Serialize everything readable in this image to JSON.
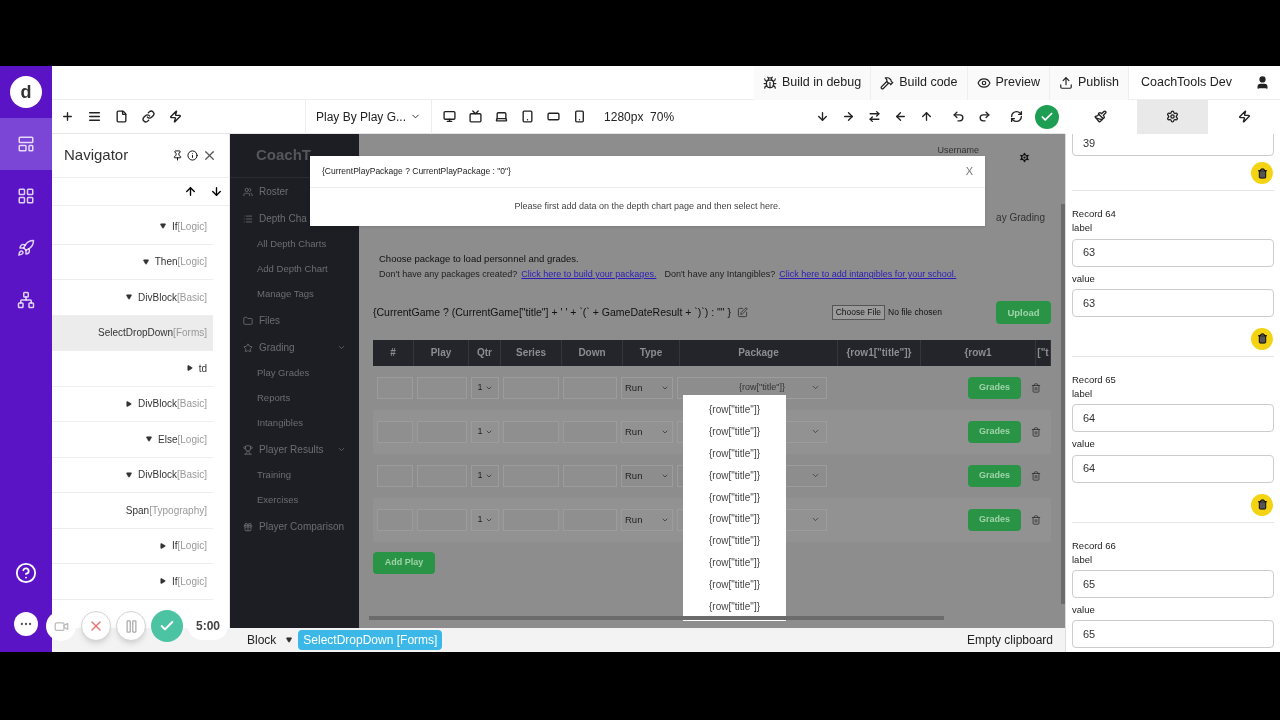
{
  "rail": {
    "logo": "d",
    "items": [
      {
        "selected": true
      },
      {
        "selected": false
      },
      {
        "selected": false
      },
      {
        "selected": false
      }
    ]
  },
  "topbar": {
    "actions": [
      {
        "kind": "debug",
        "label": "Build in debug"
      },
      {
        "kind": "build",
        "label": "Build code"
      },
      {
        "kind": "preview",
        "label": "Preview"
      },
      {
        "kind": "publish",
        "label": "Publish"
      }
    ],
    "account": "CoachTools Dev"
  },
  "toolbar": {
    "page": "Play By Play G...",
    "viewport": "1280px  70%"
  },
  "panel_tabs": [
    {
      "kind": "style",
      "selected": false
    },
    {
      "kind": "settings",
      "selected": true
    },
    {
      "kind": "actions",
      "selected": false
    }
  ],
  "navigator": {
    "title": "Navigator",
    "tree": [
      {
        "name": "If",
        "category": "[Logic]",
        "expanded": true,
        "children": [
          {
            "name": "Then",
            "category": "[Logic]",
            "expanded": true,
            "children": [
              {
                "name": "DivBlock",
                "category": "[Basic]",
                "expanded": true,
                "children": [
                  {
                    "name": "SelectDropDown",
                    "category": "[Forms]",
                    "selected": true
                  },
                  {
                    "name": "td",
                    "expanded": false,
                    "selected": false
                  }
                ],
                "selected": false
              },
              {
                "name": "DivBlock",
                "category": "[Basic]",
                "expanded": false,
                "selected": false
              }
            ],
            "selected": false
          },
          {
            "name": "Else",
            "category": "[Logic]",
            "expanded": true,
            "children": [
              {
                "name": "DivBlock",
                "category": "[Basic]",
                "expanded": true,
                "children": [
                  {
                    "name": "Span",
                    "category": "[Typography]",
                    "selected": false
                  }
                ],
                "selected": false
              }
            ],
            "selected": false
          }
        ],
        "selected": false
      },
      {
        "name": "If",
        "category": "[Logic]",
        "expanded": false,
        "selected": false
      },
      {
        "name": "If",
        "category": "[Logic]",
        "expanded": false,
        "selected": false
      }
    ]
  },
  "preview": {
    "brand": "CoachT",
    "menu": [
      {
        "label": "Roster"
      },
      {
        "label": "Depth Cha",
        "children": [
          {
            "label": "All Depth Charts"
          },
          {
            "label": "Add Depth Chart"
          },
          {
            "label": "Manage Tags"
          }
        ]
      },
      {
        "label": "Files"
      },
      {
        "label": "Grading",
        "expanded": true,
        "children": [
          {
            "label": "Play Grades"
          },
          {
            "label": "Reports"
          },
          {
            "label": "Intangibles"
          }
        ]
      },
      {
        "label": "Player Results",
        "expanded": true,
        "children": [
          {
            "label": "Training"
          },
          {
            "label": "Exercises"
          }
        ]
      },
      {
        "label": "Player Comparison"
      }
    ],
    "username": "Username",
    "tab_fragment": "ay Grading",
    "intro": "Choose package to load personnel and grades.",
    "help": [
      {
        "kind": "text",
        "text": "Don't have any packages created?"
      },
      {
        "kind": "link",
        "text": "Click here to build your packages."
      },
      {
        "kind": "text",
        "text": "Don't have any Intangibles?"
      },
      {
        "kind": "link",
        "text": "Click here to add intangibles for your school."
      }
    ],
    "game_heading": "{CurrentGame ? (CurrentGame[\"title\"] + ' ' + `(` + GameDateResult + `)`) : \"\" }",
    "file_button": "Choose File",
    "file_status": "No file chosen",
    "upload": "Upload",
    "columns": [
      "#",
      "Play",
      "Qtr",
      "Series",
      "Down",
      "Type",
      "Package",
      "{row1[\"title\"]}",
      "{row1",
      "[\"t"
    ],
    "rows": [
      {
        "qtr": "1",
        "type": "Run",
        "package": "{row[\"title\"]}",
        "grades": "Grades"
      },
      {
        "qtr": "1",
        "type": "Run",
        "grades": "Grades"
      },
      {
        "qtr": "1",
        "type": "Run",
        "grades": "Grades"
      },
      {
        "qtr": "1",
        "type": "Run",
        "grades": "Grades"
      }
    ],
    "add_play": "Add Play",
    "dropdown": [
      "{row[\"title\"]}",
      "{row[\"title\"]}",
      "{row[\"title\"]}",
      "{row[\"title\"]}",
      "{row[\"title\"]}",
      "{row[\"title\"]}",
      "{row[\"title\"]}",
      "{row[\"title\"]}",
      "{row[\"title\"]}",
      "{row[\"title\"]}"
    ],
    "modal": {
      "title": "{CurrentPlayPackage ? CurrentPlayPackage : \"0\"}",
      "close": "X",
      "message": "Please first add data on the depth chart page and then select here."
    }
  },
  "records_panel": {
    "top_value": "39",
    "records": [
      {
        "title": "Record 64",
        "fields": [
          {
            "label": "label",
            "value": "63"
          },
          {
            "label": "value",
            "value": "63"
          }
        ]
      },
      {
        "title": "Record 65",
        "fields": [
          {
            "label": "label",
            "value": "64"
          },
          {
            "label": "value",
            "value": "64"
          }
        ]
      },
      {
        "title": "Record 66",
        "fields": [
          {
            "label": "label",
            "value": "65"
          },
          {
            "label": "value",
            "value": "65"
          }
        ]
      }
    ]
  },
  "status_bar": {
    "crumb": "Block",
    "selected_chip": "SelectDropDown [Forms]",
    "clipboard": "Empty clipboard"
  },
  "recorder": {
    "timer": "5:00"
  }
}
